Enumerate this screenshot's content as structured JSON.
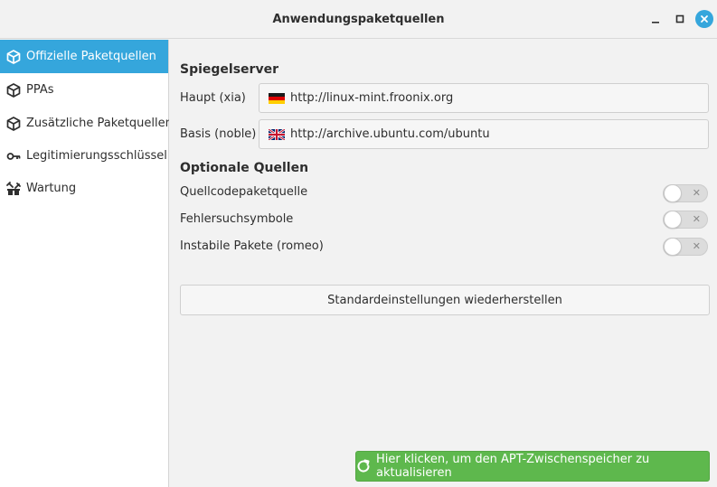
{
  "window": {
    "title": "Anwendungspaketquellen",
    "accent_color": "#35a6dc"
  },
  "sidebar": {
    "items": [
      {
        "label": "Offizielle Paketquellen",
        "icon": "package-icon",
        "active": true
      },
      {
        "label": "PPAs",
        "icon": "package-icon",
        "active": false
      },
      {
        "label": "Zusätzliche Paketquellen",
        "icon": "package-icon",
        "active": false
      },
      {
        "label": "Legitimierungsschlüssel",
        "icon": "key-icon",
        "active": false
      },
      {
        "label": "Wartung",
        "icon": "maintenance-icon",
        "active": false
      }
    ]
  },
  "mirrors": {
    "title": "Spiegelserver",
    "main_label": "Haupt (xia)",
    "main_url": "http://linux-mint.froonix.org",
    "main_flag": "germany-flag-icon",
    "base_label": "Basis (noble)",
    "base_url": "http://archive.ubuntu.com/ubuntu",
    "base_flag": "uk-flag-icon"
  },
  "optional": {
    "title": "Optionale Quellen",
    "items": [
      {
        "label": "Quellcodepaketquelle",
        "enabled": false
      },
      {
        "label": "Fehlersuchsymbole",
        "enabled": false
      },
      {
        "label": "Instabile Pakete (romeo)",
        "enabled": false
      }
    ]
  },
  "buttons": {
    "reset_label": "Standardeinstellungen wiederherstellen",
    "apt_label": "Hier klicken, um den APT-Zwischenspeicher zu aktualisieren",
    "apt_color": "#5eb84d"
  }
}
